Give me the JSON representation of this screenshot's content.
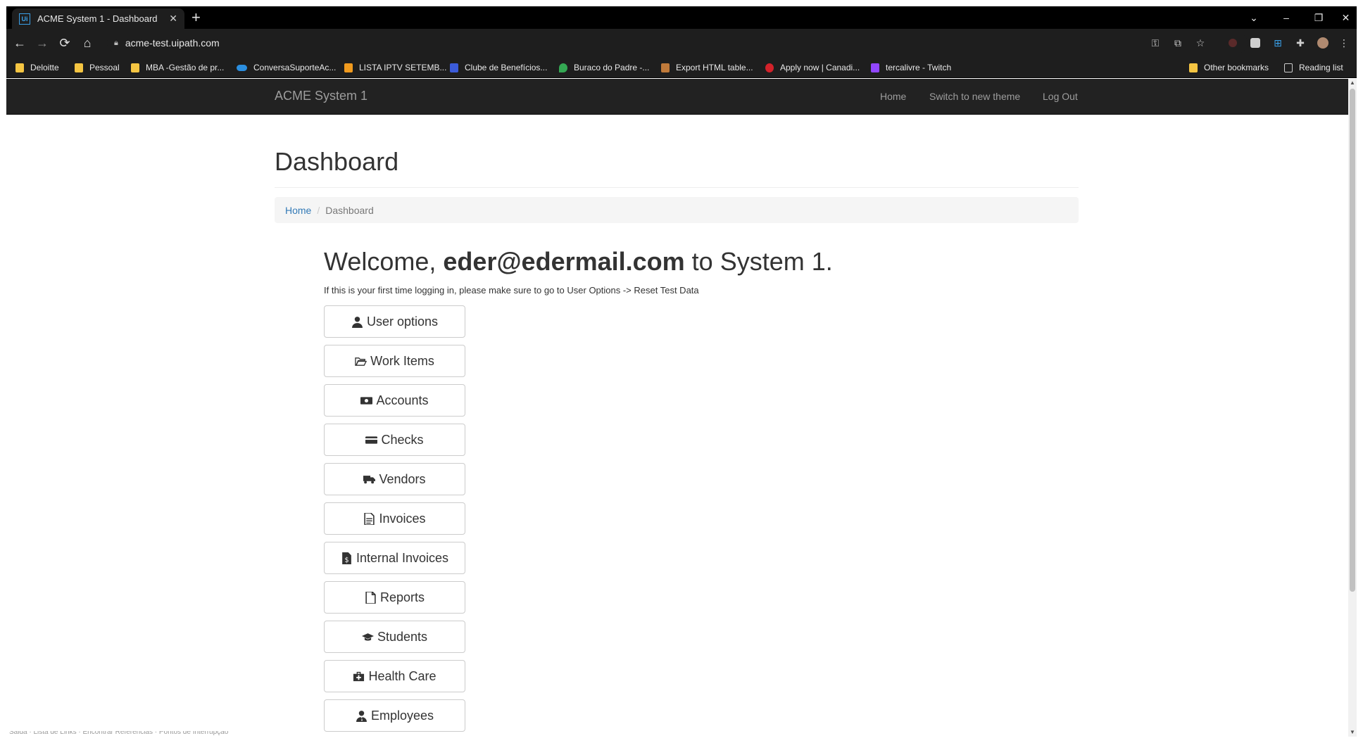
{
  "browser": {
    "tab_title": "ACME System 1 - Dashboard",
    "tab_favicon": "Ui",
    "url": "acme-test.uipath.com",
    "bookmarks": [
      "Deloitte",
      "Pessoal",
      "MBA -Gestão de pr...",
      "ConversaSuporteAc...",
      "LISTA IPTV SETEMB...",
      "Clube de Benefícios...",
      "Buraco do Padre -...",
      "Export HTML table...",
      "Apply now | Canadi...",
      "tercalivre - Twitch"
    ],
    "other_bookmarks": "Other bookmarks",
    "reading_list": "Reading list"
  },
  "app": {
    "brand": "ACME System 1",
    "nav": {
      "home": "Home",
      "theme": "Switch to new theme",
      "logout": "Log Out"
    },
    "page_title": "Dashboard",
    "breadcrumb": {
      "home": "Home",
      "current": "Dashboard"
    },
    "welcome": {
      "prefix": "Welcome,",
      "user": "eder@edermail.com",
      "suffix": "to System 1."
    },
    "note": "If this is your first time logging in, please make sure to go to User Options -> Reset Test Data",
    "buttons": [
      {
        "label": "User options",
        "icon": "user-icon"
      },
      {
        "label": "Work Items",
        "icon": "folder-open-icon"
      },
      {
        "label": "Accounts",
        "icon": "money-icon"
      },
      {
        "label": "Checks",
        "icon": "credit-card-icon"
      },
      {
        "label": "Vendors",
        "icon": "truck-icon"
      },
      {
        "label": "Invoices",
        "icon": "file-text-icon"
      },
      {
        "label": "Internal Invoices",
        "icon": "file-invoice-icon"
      },
      {
        "label": "Reports",
        "icon": "file-icon"
      },
      {
        "label": "Students",
        "icon": "graduation-cap-icon"
      },
      {
        "label": "Health Care",
        "icon": "medkit-icon"
      },
      {
        "label": "Employees",
        "icon": "user-tie-icon"
      }
    ]
  },
  "status_text": "Salda · Lista de Links · Encontrar Referências · Pontos de Interrupção"
}
